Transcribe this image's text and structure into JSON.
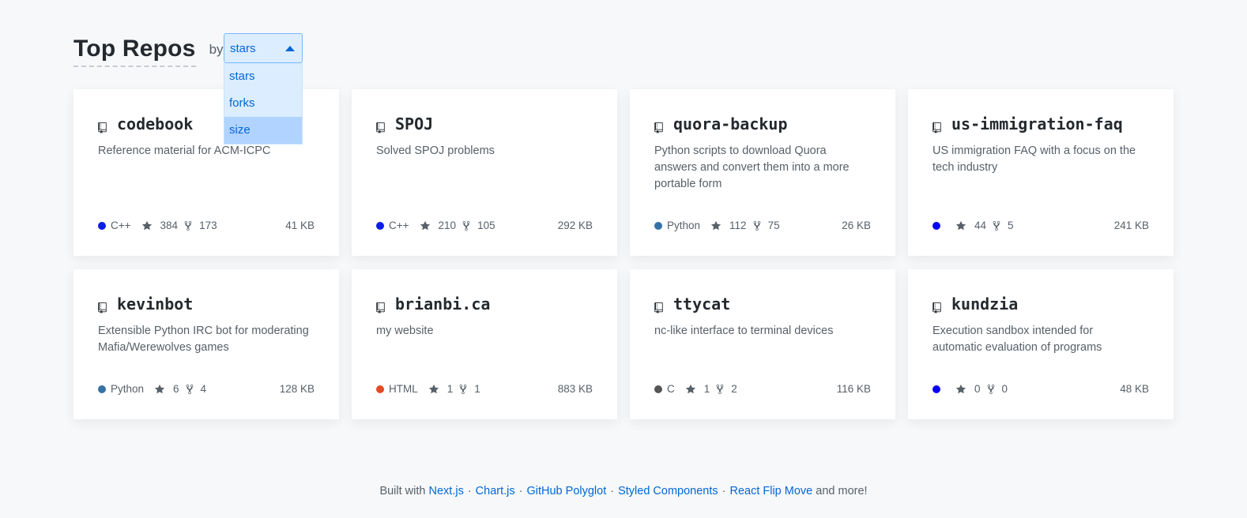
{
  "header": {
    "title": "Top Repos",
    "by_label": "by"
  },
  "sort_dropdown": {
    "selected": "stars",
    "options": [
      "stars",
      "forks",
      "size"
    ],
    "highlighted": "size"
  },
  "repos": [
    {
      "name": "codebook",
      "description": "Reference material for ACM-ICPC",
      "language": "C++",
      "lang_color": "#0b1ee6",
      "stars": "384",
      "forks": "173",
      "size": "41 KB"
    },
    {
      "name": "SPOJ",
      "description": "Solved SPOJ problems",
      "language": "C++",
      "lang_color": "#0b1ee6",
      "stars": "210",
      "forks": "105",
      "size": "292 KB"
    },
    {
      "name": "quora-backup",
      "description": "Python scripts to download Quora answers and convert them into a more portable form",
      "language": "Python",
      "lang_color": "#3572a5",
      "stars": "112",
      "forks": "75",
      "size": "26 KB"
    },
    {
      "name": "us-immigration-faq",
      "description": "US immigration FAQ with a focus on the tech industry",
      "language": "",
      "lang_color": "#0b00f0",
      "stars": "44",
      "forks": "5",
      "size": "241 KB"
    },
    {
      "name": "kevinbot",
      "description": "Extensible Python IRC bot for moderating Mafia/Werewolves games",
      "language": "Python",
      "lang_color": "#3572a5",
      "stars": "6",
      "forks": "4",
      "size": "128 KB"
    },
    {
      "name": "brianbi.ca",
      "description": "my website",
      "language": "HTML",
      "lang_color": "#e34c26",
      "stars": "1",
      "forks": "1",
      "size": "883 KB"
    },
    {
      "name": "ttycat",
      "description": "nc-like interface to terminal devices",
      "language": "C",
      "lang_color": "#555555",
      "stars": "1",
      "forks": "2",
      "size": "116 KB"
    },
    {
      "name": "kundzia",
      "description": "Execution sandbox intended for automatic evaluation of programs",
      "language": "",
      "lang_color": "#0b00f0",
      "stars": "0",
      "forks": "0",
      "size": "48 KB"
    }
  ],
  "footer": {
    "prefix": "Built with",
    "links": [
      "Next.js",
      "Chart.js",
      "GitHub Polyglot",
      "Styled Components",
      "React Flip Move"
    ],
    "separator": "·",
    "suffix": "and more!"
  },
  "icons": {
    "repo": "repo-icon",
    "star": "star-icon",
    "fork": "fork-icon",
    "caret": "caret-up-icon"
  }
}
